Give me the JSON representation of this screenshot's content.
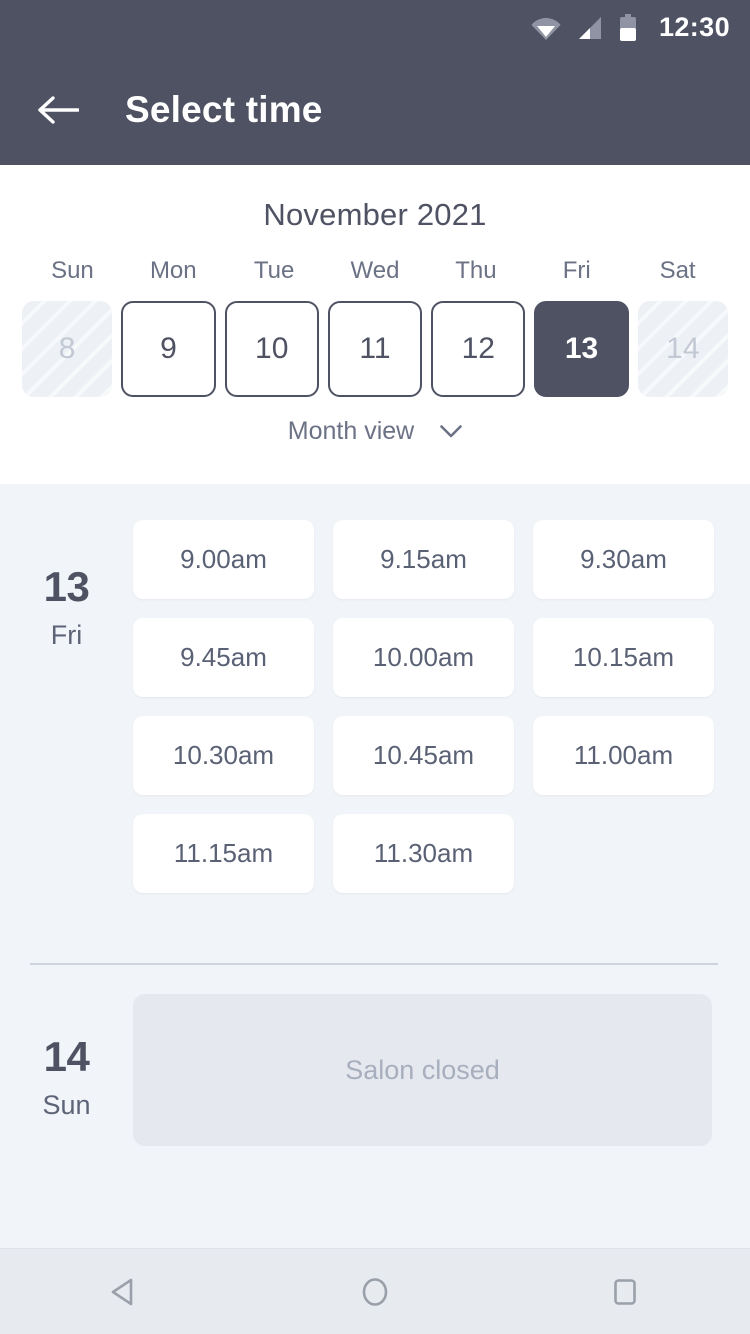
{
  "status_bar": {
    "time": "12:30",
    "icons": [
      "wifi-icon",
      "signal-icon",
      "battery-icon"
    ]
  },
  "app_bar": {
    "back_icon": "back-arrow-icon",
    "title": "Select time"
  },
  "calendar": {
    "month_title": "November 2021",
    "weekdays": [
      "Sun",
      "Mon",
      "Tue",
      "Wed",
      "Thu",
      "Fri",
      "Sat"
    ],
    "days": [
      {
        "number": "8",
        "state": "disabled"
      },
      {
        "number": "9",
        "state": "normal"
      },
      {
        "number": "10",
        "state": "normal"
      },
      {
        "number": "11",
        "state": "normal"
      },
      {
        "number": "12",
        "state": "normal"
      },
      {
        "number": "13",
        "state": "selected"
      },
      {
        "number": "14",
        "state": "disabled"
      }
    ],
    "month_view_label": "Month view",
    "month_view_icon": "chevron-down-icon"
  },
  "schedule": [
    {
      "day_number": "13",
      "day_name": "Fri",
      "slots": [
        "9.00am",
        "9.15am",
        "9.30am",
        "9.45am",
        "10.00am",
        "10.15am",
        "10.30am",
        "10.45am",
        "11.00am",
        "11.15am",
        "11.30am"
      ]
    },
    {
      "day_number": "14",
      "day_name": "Sun",
      "closed_label": "Salon closed"
    }
  ],
  "nav_bar": {
    "back_icon": "triangle-back-icon",
    "home_icon": "circle-home-icon",
    "recents_icon": "square-recents-icon"
  },
  "colors": {
    "header_bg": "#4e5263",
    "page_bg": "#f1f4f8",
    "panel_bg": "#ffffff",
    "accent": "#4e5263",
    "muted_text": "#6b7285",
    "disabled_text": "#c2c8d4",
    "closed_bg": "#e5e9ef",
    "nav_bg": "#e7eaef"
  }
}
